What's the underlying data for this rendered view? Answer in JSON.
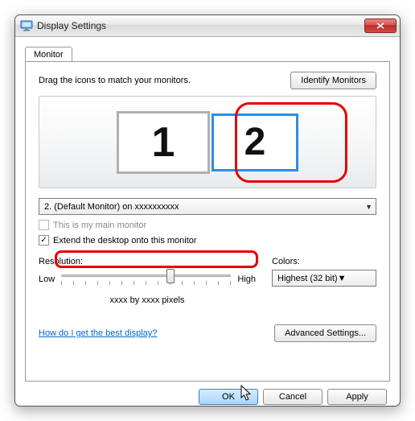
{
  "window": {
    "title": "Display Settings"
  },
  "tab": {
    "label": "Monitor"
  },
  "instruction": "Drag the icons to match your monitors.",
  "buttons": {
    "identify": "Identify Monitors",
    "advanced": "Advanced Settings...",
    "ok": "OK",
    "cancel": "Cancel",
    "apply": "Apply"
  },
  "monitors": {
    "m1": "1",
    "m2": "2"
  },
  "dropdown": {
    "selected": "2. (Default Monitor) on xxxxxxxxxx"
  },
  "checkboxes": {
    "main": {
      "label": "This is my main monitor",
      "checked": false,
      "disabled": true
    },
    "extend": {
      "label": "Extend the desktop onto this monitor",
      "checked": true,
      "disabled": false
    }
  },
  "resolution": {
    "label": "Resolution:",
    "low": "Low",
    "high": "High",
    "text": "xxxx by xxxx pixels"
  },
  "colors": {
    "label": "Colors:",
    "selected": "Highest (32 bit)"
  },
  "help_link": "How do I get the best display?"
}
